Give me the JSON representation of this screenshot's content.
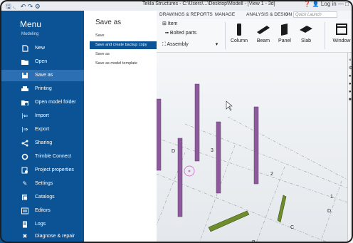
{
  "window": {
    "title": "Tekla Structures - C:\\Users\\...\\Desktop\\Modell - [View 1 - 3d]",
    "quick_access": "🖫 ◟ ↶ ↷ ⚙",
    "right_controls": "❓ 👤 Log in  —  □"
  },
  "ribbon": {
    "tabs": [
      "DRAWINGS & REPORTS",
      "MANAGE",
      "ANALYSIS & DESIGN",
      ">"
    ],
    "search_placeholder": "Quick Launch",
    "items": [
      "Item",
      "Bolted parts",
      "Assembly"
    ],
    "buttons": [
      "Column",
      "Beam",
      "Panel",
      "Slab",
      "Window"
    ]
  },
  "menu": {
    "title": "Menu",
    "subtitle": "Modeling",
    "items": [
      {
        "label": "New",
        "icon": "new-file-icon"
      },
      {
        "label": "Open",
        "icon": "folder-icon"
      },
      {
        "label": "Save as",
        "icon": "save-icon"
      },
      {
        "label": "Printing",
        "icon": "printer-icon"
      },
      {
        "label": "Open model folder",
        "icon": "folder-gear-icon"
      },
      {
        "label": "Import",
        "icon": "import-icon"
      },
      {
        "label": "Export",
        "icon": "export-icon"
      },
      {
        "label": "Sharing",
        "icon": "share-icon"
      },
      {
        "label": "Trimble Connect",
        "icon": "trimble-icon"
      },
      {
        "label": "Project properties",
        "icon": "project-properties-icon"
      },
      {
        "label": "Settings",
        "icon": "settings-icon"
      },
      {
        "label": "Catalogs",
        "icon": "catalog-icon"
      },
      {
        "label": "Editors",
        "icon": "editors-icon"
      },
      {
        "label": "Logs",
        "icon": "logs-icon"
      },
      {
        "label": "Diagnose & repair",
        "icon": "diagnose-icon"
      }
    ],
    "selected": "Save as"
  },
  "submenu": {
    "title": "Save as",
    "items": [
      "Save",
      "Save and create backup copy",
      "Save as",
      "Save as model template"
    ],
    "selected": "Save and create backup copy"
  },
  "viewport": {
    "grid_labels": [
      "D",
      "3",
      "2",
      "1",
      "D.",
      "C",
      "B"
    ]
  },
  "colors": {
    "menu_bg": "#0b5394",
    "menu_selected": "#2c6fb2",
    "column": "#8d5a9c",
    "beam": "#6f8d2c"
  }
}
